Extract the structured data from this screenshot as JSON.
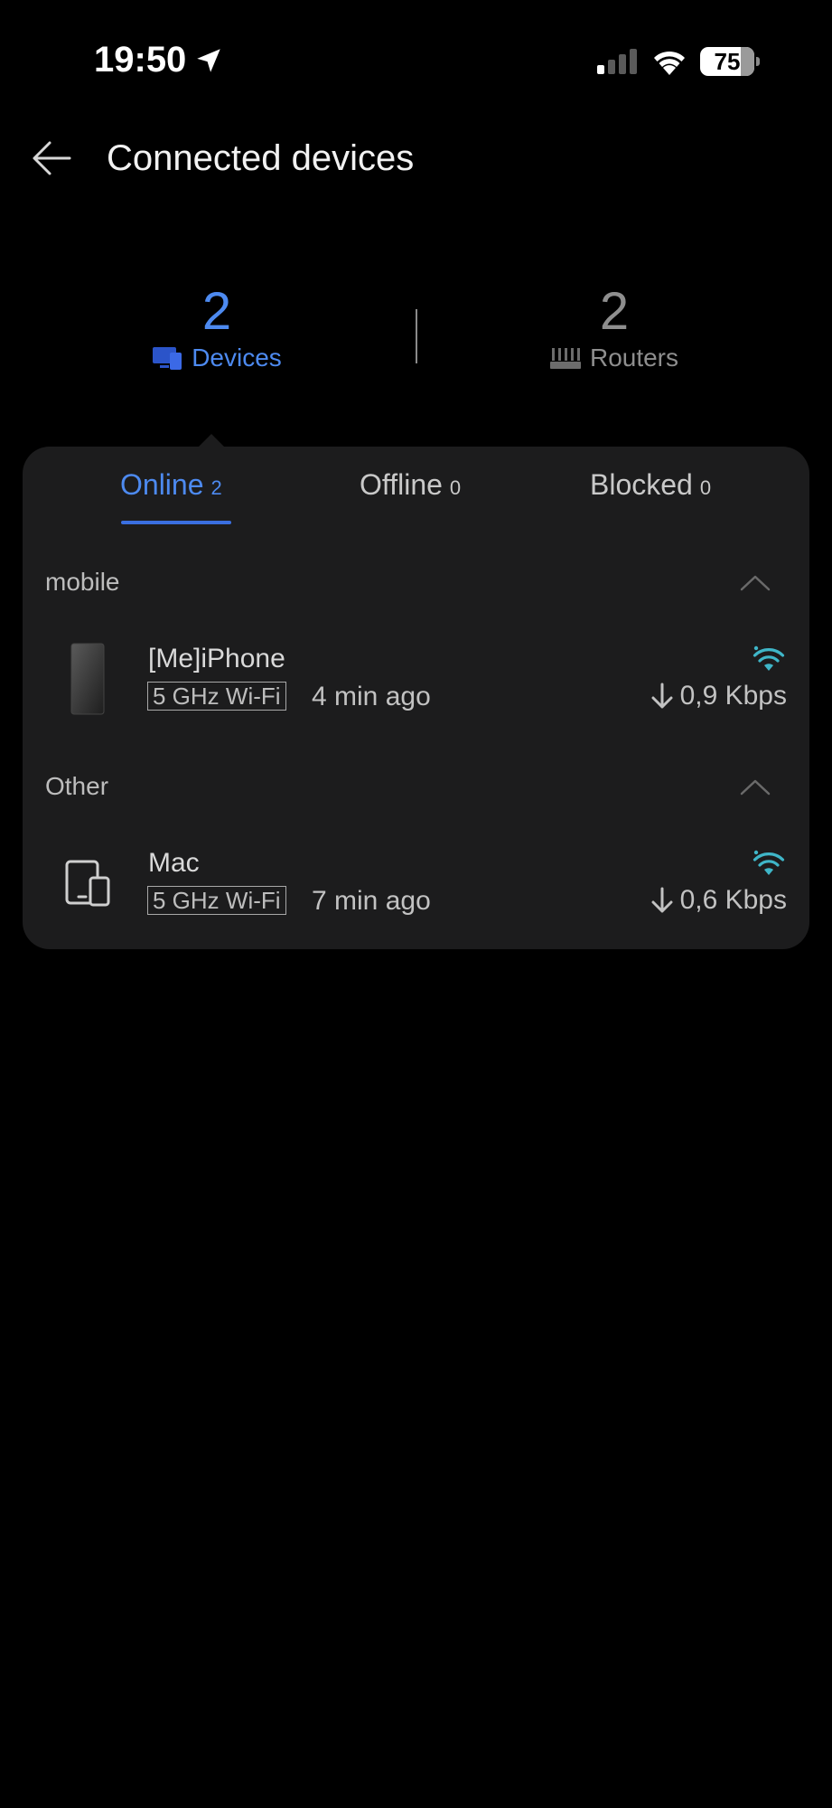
{
  "status_bar": {
    "time": "19:50",
    "battery": "75",
    "icons": [
      "location-arrow-icon",
      "cellular-signal-icon",
      "wifi-icon",
      "battery-icon"
    ]
  },
  "header": {
    "title": "Connected devices",
    "back_icon": "back-arrow-icon"
  },
  "summary": {
    "devices": {
      "count": "2",
      "label": "Devices",
      "icon": "devices-icon"
    },
    "routers": {
      "count": "2",
      "label": "Routers",
      "icon": "router-icon"
    }
  },
  "tabs": [
    {
      "label": "Online",
      "count": "2",
      "active": true
    },
    {
      "label": "Offline",
      "count": "0",
      "active": false
    },
    {
      "label": "Blocked",
      "count": "0",
      "active": false
    }
  ],
  "groups": [
    {
      "title": "mobile",
      "devices": [
        {
          "name": "[Me]iPhone",
          "band": "5 GHz Wi-Fi",
          "last_seen": "4 min ago",
          "speed": "0,9 Kbps",
          "icon": "phone-icon"
        }
      ]
    },
    {
      "title": "Other",
      "devices": [
        {
          "name": "Mac",
          "band": "5 GHz Wi-Fi",
          "last_seen": "7 min ago",
          "speed": "0,6 Kbps",
          "icon": "tablet-phone-icon"
        }
      ]
    }
  ],
  "colors": {
    "accent": "#4d8af0",
    "card_background": "#1c1c1d",
    "wifi_indicator": "#3fb6c8"
  }
}
